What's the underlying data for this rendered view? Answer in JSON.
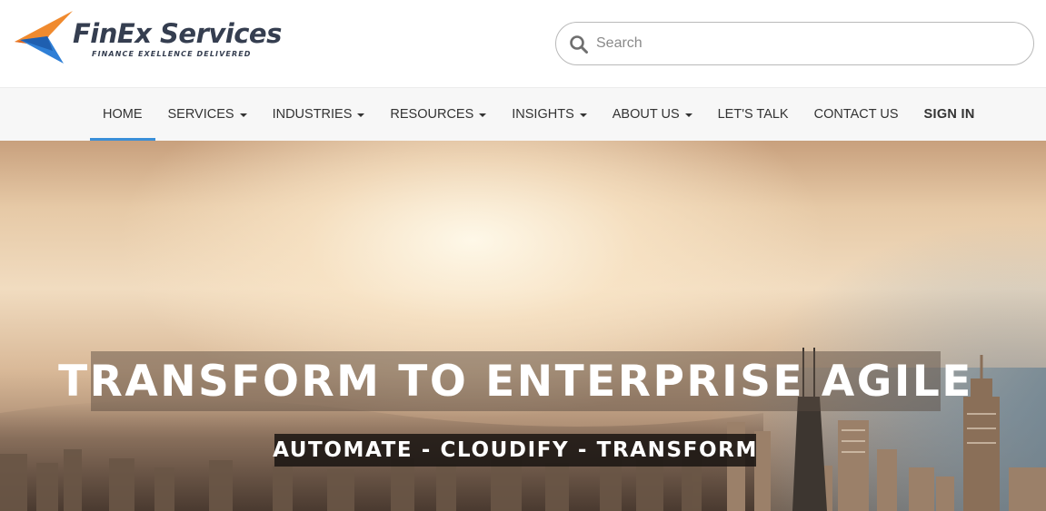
{
  "brand": {
    "name": "FinEx Services",
    "tagline": "FINANCE EXELLENCE DELIVERED",
    "colors": {
      "orange": "#f08a2e",
      "blue": "#2f7fd6",
      "text": "#353e50"
    }
  },
  "search": {
    "placeholder": "Search",
    "value": "",
    "icon": "search-icon"
  },
  "nav": {
    "items": [
      {
        "label": "HOME",
        "active": true,
        "dropdown": false
      },
      {
        "label": "SERVICES",
        "dropdown": true
      },
      {
        "label": "INDUSTRIES",
        "dropdown": true
      },
      {
        "label": "RESOURCES",
        "dropdown": true
      },
      {
        "label": "INSIGHTS",
        "dropdown": true
      },
      {
        "label": "ABOUT US",
        "dropdown": true
      },
      {
        "label": "LET'S TALK",
        "dropdown": false
      },
      {
        "label": "CONTACT US",
        "dropdown": false
      },
      {
        "label": "SIGN IN",
        "dropdown": false,
        "bold": true
      }
    ],
    "active_color": "#3a8fd8"
  },
  "hero": {
    "title": "TRANSFORM TO ENTERPRISE AGILE",
    "subtitle": "AUTOMATE - CLOUDIFY - TRANSFORM"
  }
}
